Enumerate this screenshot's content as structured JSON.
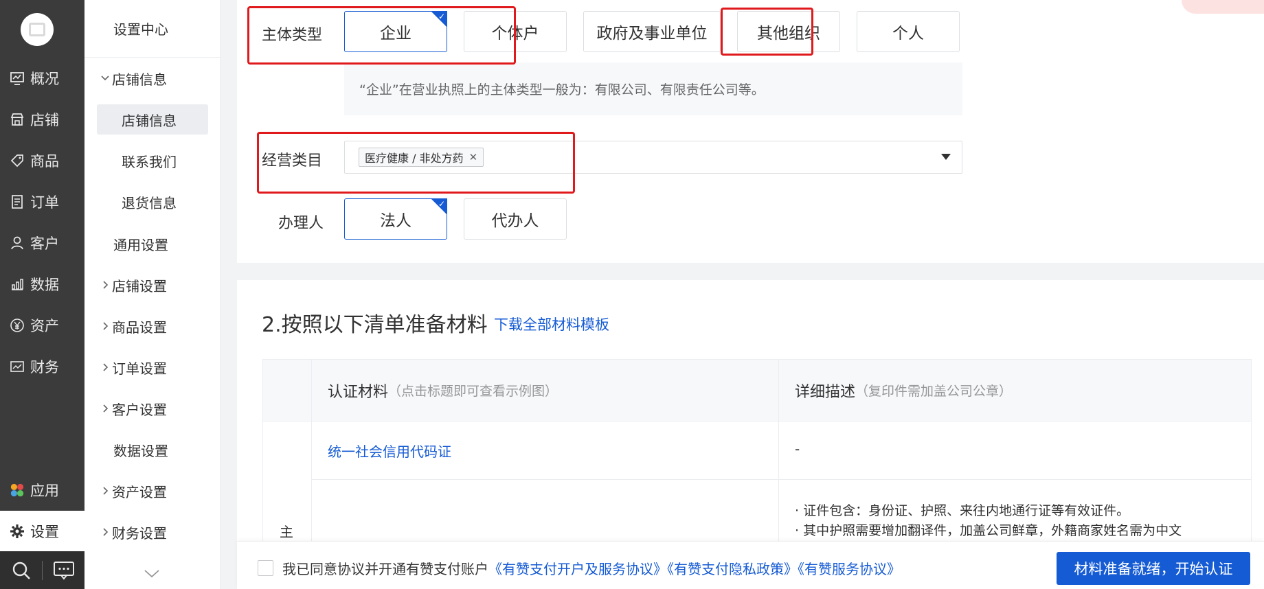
{
  "nav": {
    "items": [
      {
        "label": "概况",
        "icon": "overview-icon"
      },
      {
        "label": "店铺",
        "icon": "store-icon"
      },
      {
        "label": "商品",
        "icon": "tag-icon"
      },
      {
        "label": "订单",
        "icon": "order-icon"
      },
      {
        "label": "客户",
        "icon": "user-icon"
      },
      {
        "label": "数据",
        "icon": "chart-icon"
      },
      {
        "label": "资产",
        "icon": "yuan-icon"
      },
      {
        "label": "财务",
        "icon": "finance-icon"
      },
      {
        "label": "应用",
        "icon": "apps-icon"
      },
      {
        "label": "设置",
        "icon": "gear-icon"
      }
    ]
  },
  "sidebar": {
    "title": "设置中心",
    "items": [
      {
        "label": "店铺信息"
      },
      {
        "label": "店铺信息"
      },
      {
        "label": "联系我们"
      },
      {
        "label": "退货信息"
      },
      {
        "label": "通用设置"
      },
      {
        "label": "店铺设置"
      },
      {
        "label": "商品设置"
      },
      {
        "label": "订单设置"
      },
      {
        "label": "客户设置"
      },
      {
        "label": "数据设置"
      },
      {
        "label": "资产设置"
      },
      {
        "label": "财务设置"
      }
    ]
  },
  "form": {
    "subject_label": "主体类型",
    "subject_options": [
      "企业",
      "个体户",
      "政府及事业单位",
      "其他组织",
      "个人"
    ],
    "subject_selected": "企业",
    "hint": "“企业”在营业执照上的主体类型一般为：有限公司、有限责任公司等。",
    "category_label": "经营类目",
    "category_tag": "医疗健康 / 非处方药",
    "handler_label": "办理人",
    "handler_options": [
      "法人",
      "代办人"
    ],
    "handler_selected": "法人"
  },
  "section2": {
    "title": "2.按照以下清单准备材料",
    "link": "下载全部材料模板",
    "col1_title": "认证材料",
    "col1_sub": "（点击标题即可查看示例图）",
    "col2_title": "详细描述",
    "col2_sub": "（复印件需加盖公司公章）",
    "row_group": "主",
    "row1_material": "统一社会信用代码证",
    "row1_desc": "-",
    "row2_desc_line1": "· 证件包含：身份证、护照、来往内地通行证等有效证件。",
    "row2_desc_line2": "· 其中护照需要增加翻译件，加盖公司鲜章，外籍商家姓名需为中文"
  },
  "footer": {
    "agree_prefix": "我已同意协议并开通有赞支付账户",
    "agree_link1": "《有赞支付开户及服务协议》",
    "agree_link2": "《有赞支付隐私政策》",
    "agree_link3": "《有赞服务协议》",
    "submit": "材料准备就绪，开始认证"
  },
  "colors": {
    "accent": "#155bd4",
    "highlight": "#e0191c",
    "nav_bg": "#3b3b3b"
  }
}
